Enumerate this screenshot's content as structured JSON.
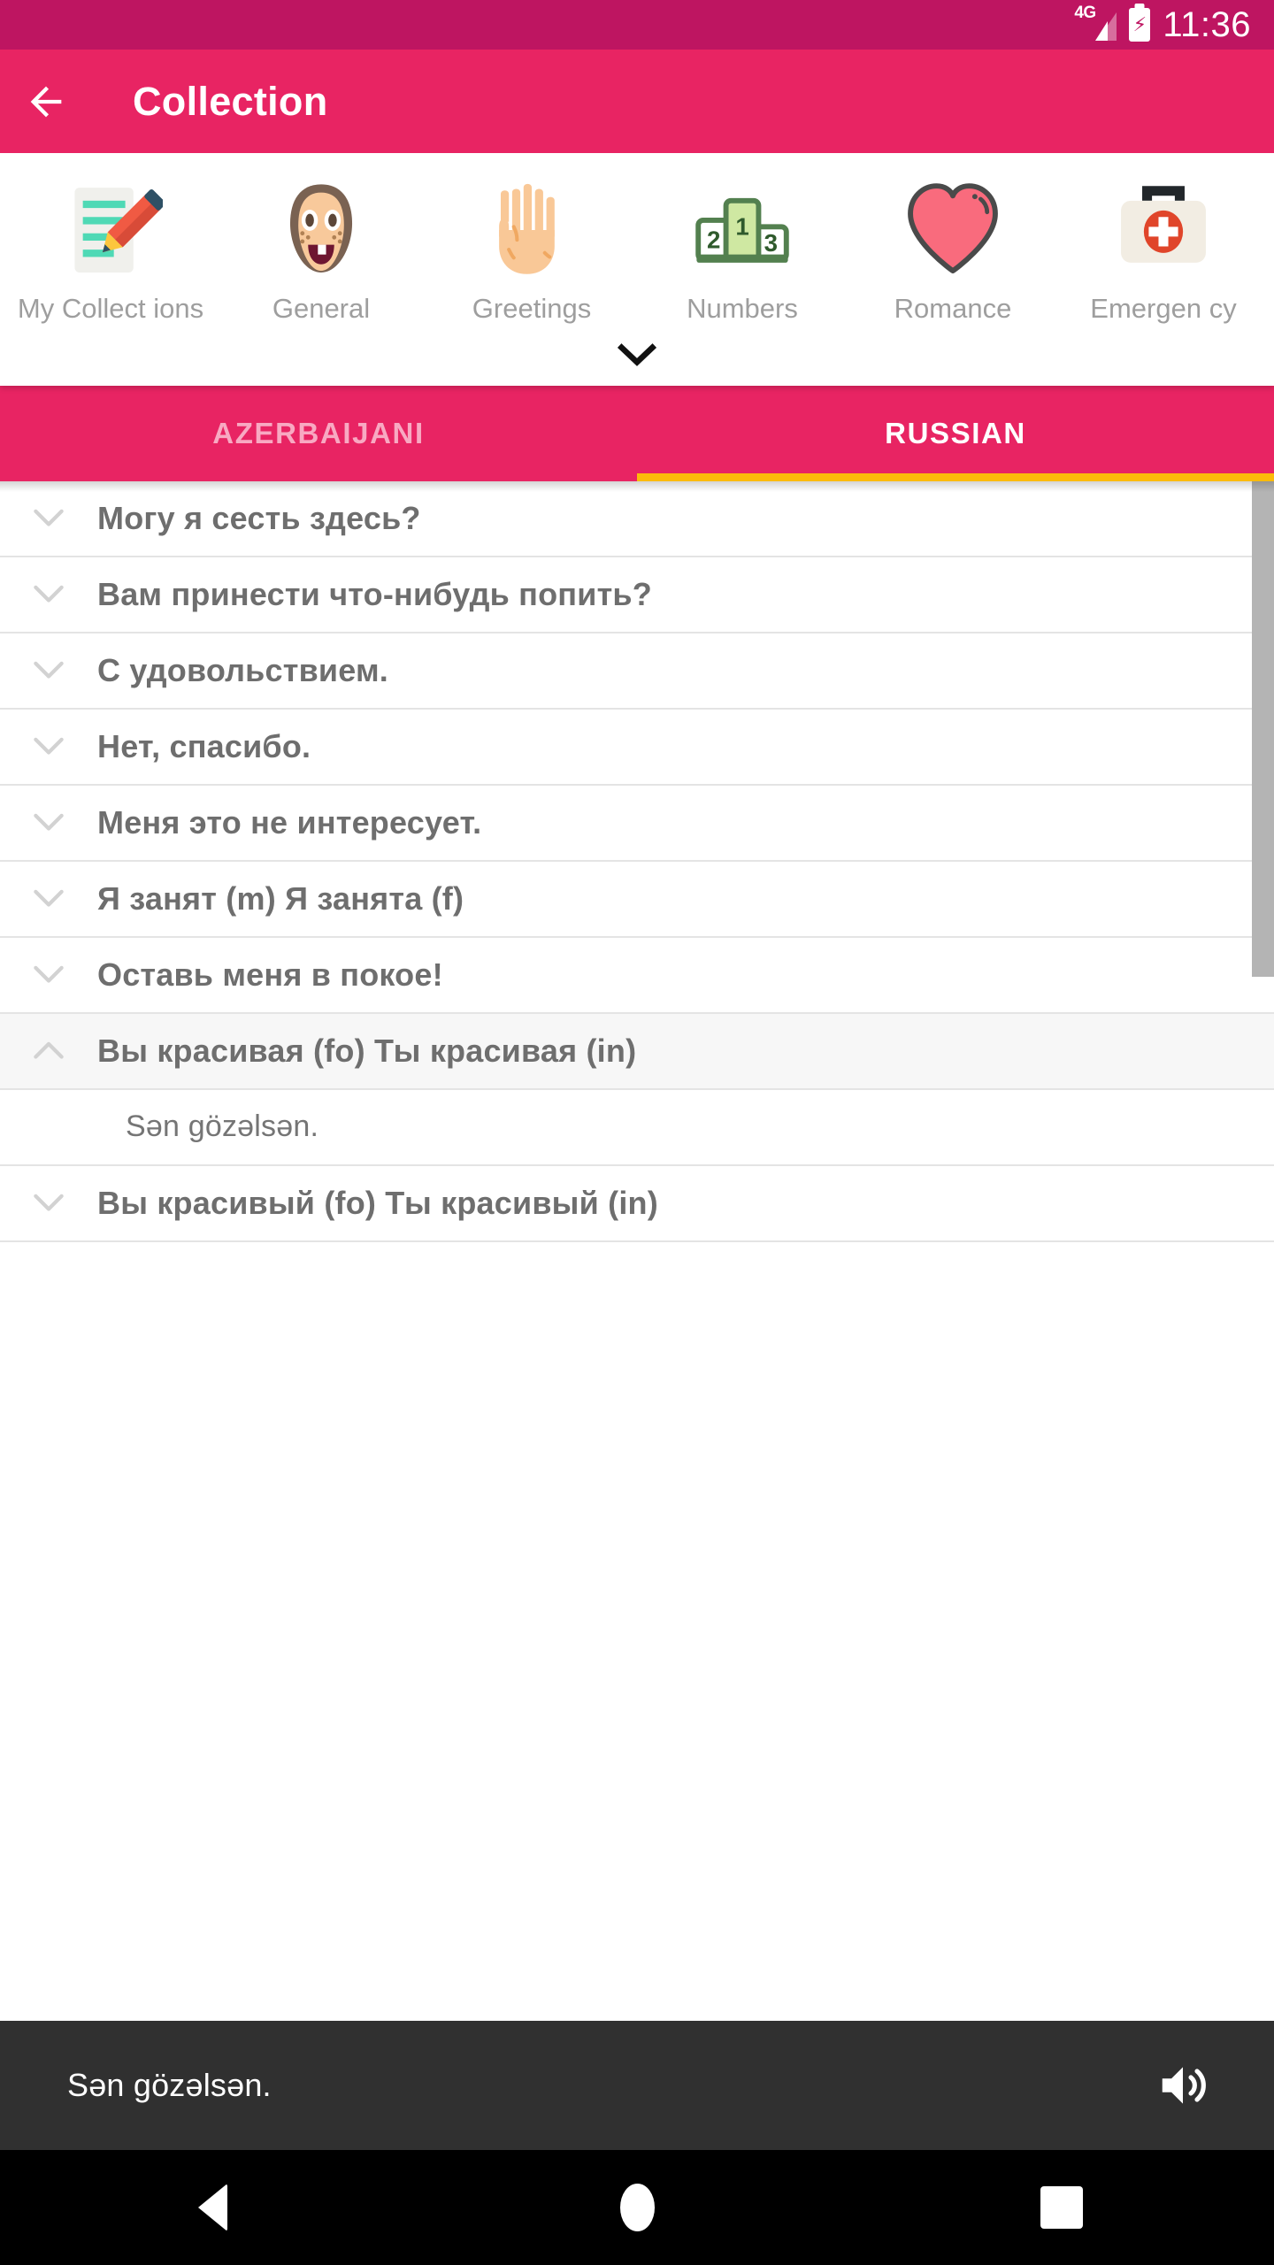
{
  "status_bar": {
    "network_label": "4G",
    "time": "11:36",
    "battery_state": "charging",
    "background_color": "#BE1561"
  },
  "app_bar": {
    "title": "Collection",
    "back_label": "Back",
    "background_color": "#E82463"
  },
  "categories": {
    "expand_label": "Show more categories",
    "items": [
      {
        "label": "My Collect ions",
        "icon": "notepad-pencil-icon"
      },
      {
        "label": "General",
        "icon": "girl-face-icon"
      },
      {
        "label": "Greetings",
        "icon": "raised-hand-icon"
      },
      {
        "label": "Numbers",
        "icon": "podium-123-icon"
      },
      {
        "label": "Romance",
        "icon": "heart-icon"
      },
      {
        "label": "Emergen cy",
        "icon": "first-aid-kit-icon"
      }
    ]
  },
  "tabs": {
    "indicator_color": "#FCBB0A",
    "items": [
      {
        "label": "AZERBAIJANI",
        "active": false
      },
      {
        "label": "RUSSIAN",
        "active": true
      }
    ]
  },
  "phrase_list": {
    "rows": [
      {
        "text": "Могу я сесть здесь?",
        "expanded": false
      },
      {
        "text": "Вам принести что-нибудь попить?",
        "expanded": false
      },
      {
        "text": "С удовольствием.",
        "expanded": false
      },
      {
        "text": "Нет, спасибо.",
        "expanded": false
      },
      {
        "text": "Меня это не интересует.",
        "expanded": false
      },
      {
        "text": "Я занят (m)  Я занята (f)",
        "expanded": false
      },
      {
        "text": "Оставь меня в покое!",
        "expanded": false
      },
      {
        "text": "Вы красивая (fo)  Ты красивая (in)",
        "expanded": true
      },
      {
        "text": "Sən gözəlsən.",
        "translation": true
      },
      {
        "text": "Вы красивый (fo)  Ты красивый (in)",
        "expanded": false
      }
    ]
  },
  "player_bar": {
    "text": "Sən gözəlsən.",
    "speaker_icon": "volume-up-icon",
    "background_color": "#303030"
  },
  "nav_bar": {
    "back_label": "Back",
    "home_label": "Home",
    "recents_label": "Recents"
  }
}
